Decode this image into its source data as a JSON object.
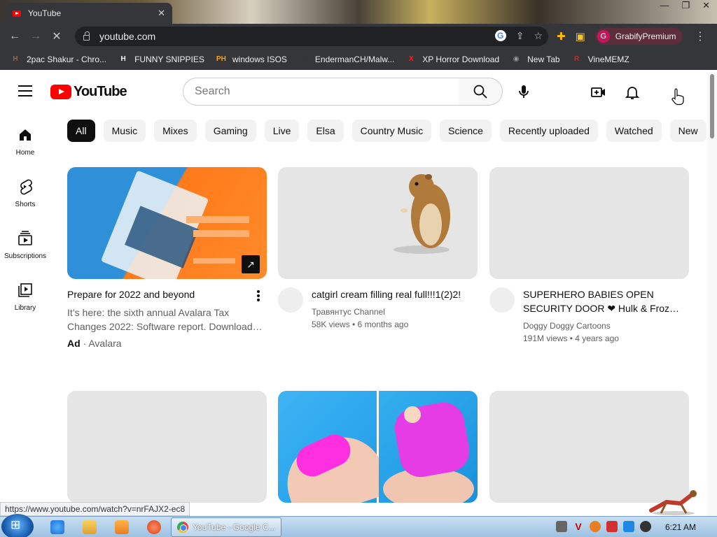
{
  "browser": {
    "tab_title": "YouTube",
    "tab_close": "✕",
    "window_controls": [
      "—",
      "❐",
      "✕"
    ],
    "url": "youtube.com",
    "profile_initial": "G",
    "profile_name": "GrabifyPremium",
    "bookmarks": [
      {
        "label": "2pac Shakur - Chro...",
        "icon": "H",
        "color": "#8a6a50"
      },
      {
        "label": "FUNNY SNIPPIES",
        "icon": "H",
        "color": "#ffffff"
      },
      {
        "label": "windows ISOS",
        "icon": "PH",
        "color": "#f7a21b"
      },
      {
        "label": "EndermanCH/Malw...",
        "icon": "Y",
        "color": "#333333"
      },
      {
        "label": "XP Horror Download",
        "icon": "X",
        "color": "#ff2222"
      },
      {
        "label": "New Tab",
        "icon": "◉",
        "color": "#999999"
      },
      {
        "label": "VineMEMZ",
        "icon": "R",
        "color": "#c62828"
      }
    ],
    "status_url": "https://www.youtube.com/watch?v=nrFAJX2-ec8"
  },
  "youtube": {
    "logo_text": "YouTube",
    "search_placeholder": "Search",
    "chips": [
      "All",
      "Music",
      "Mixes",
      "Gaming",
      "Live",
      "Elsa",
      "Country Music",
      "Science",
      "Recently uploaded",
      "Watched",
      "New"
    ],
    "sidebar": [
      {
        "label": "Home"
      },
      {
        "label": "Shorts"
      },
      {
        "label": "Subscriptions"
      },
      {
        "label": "Library"
      }
    ],
    "ad": {
      "title": "Prepare for 2022 and beyond",
      "desc": "It’s here: the sixth annual Avalara Tax Changes 2022: Software report. Download…",
      "ad_label": "Ad",
      "advertiser": "Avalara",
      "thumb_color": "#2f8fd8"
    },
    "videos": [
      {
        "title": "catgirl cream filling real full!!!1(2)2!",
        "channel": "Травянтус Channel",
        "stats": "58K views • 6 months ago"
      },
      {
        "title": "SUPERHERO BABIES OPEN SECURITY DOOR ❤ Hulk & Froz…",
        "channel": "Doggy Doggy Cartoons",
        "stats": "191M views • 4 years ago"
      }
    ]
  },
  "taskbar": {
    "task_label": "YouTube - Google C...",
    "clock": "6:21 AM"
  }
}
